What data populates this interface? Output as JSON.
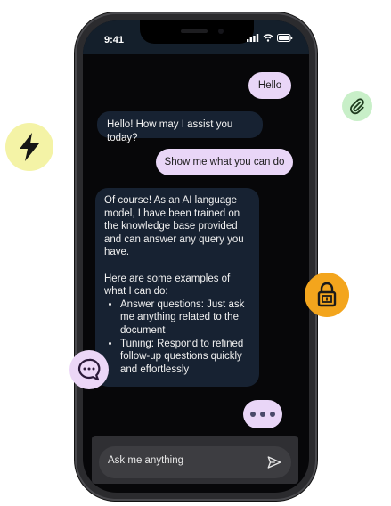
{
  "status_bar": {
    "time": "9:41"
  },
  "messages": [
    {
      "role": "user",
      "text": "Hello"
    },
    {
      "role": "assistant",
      "text": "Hello! How may I assist you today?"
    },
    {
      "role": "user",
      "text": "Show me what you can do"
    },
    {
      "role": "assistant",
      "intro": "Of course! As an AI language model, I have been trained on the knowledge base provided and can answer any query you have.",
      "examples_heading": "Here are some examples of what I can do:",
      "bullets": [
        "Answer questions: Just ask me anything related to the document",
        "Tuning: Respond to refined follow-up questions quickly and effortlessly"
      ]
    }
  ],
  "composer": {
    "placeholder": "Ask me anything"
  },
  "icons": {
    "floating": [
      "lightning-icon",
      "paperclip-icon",
      "lock-icon",
      "chat-icon"
    ],
    "status": [
      "signal-icon",
      "wifi-icon",
      "battery-icon"
    ],
    "send": "send-icon"
  },
  "colors": {
    "user_bubble": "#e9d6f7",
    "assistant_bubble": "#172232",
    "screen_bg": "#070709",
    "lightning_badge": "#f4f3a6",
    "paperclip_badge": "#c8efc8",
    "lock_badge": "#f3a51d",
    "chat_badge": "#ecd7f7"
  }
}
